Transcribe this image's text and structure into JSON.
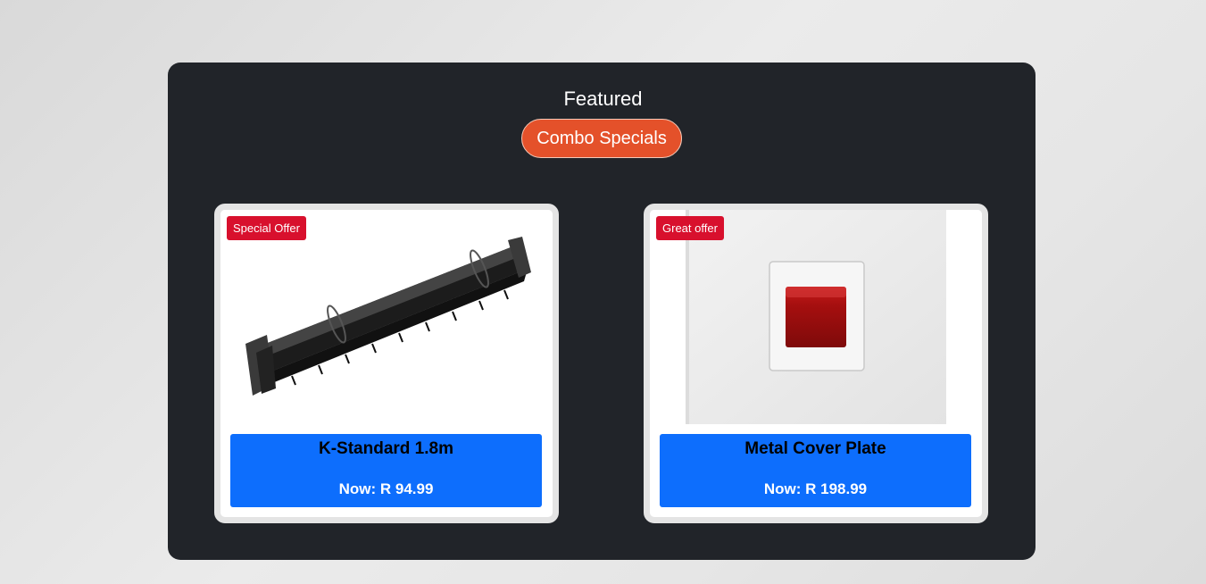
{
  "featured": {
    "title": "Featured",
    "button_label": "Combo Specials"
  },
  "products": [
    {
      "badge": "Special Offer",
      "name": "K-Standard 1.8m",
      "price": "Now: R 94.99",
      "image": "black-plastic-k-standard-spacer"
    },
    {
      "badge": "Great offer",
      "name": "Metal Cover Plate",
      "price": "Now: R 198.99",
      "image": "white-plate-with-red-switch"
    }
  ],
  "colors": {
    "panel_bg": "#212429",
    "button_bg": "#e4512a",
    "badge_bg": "#d8102d",
    "info_bg": "#0d6efd"
  }
}
